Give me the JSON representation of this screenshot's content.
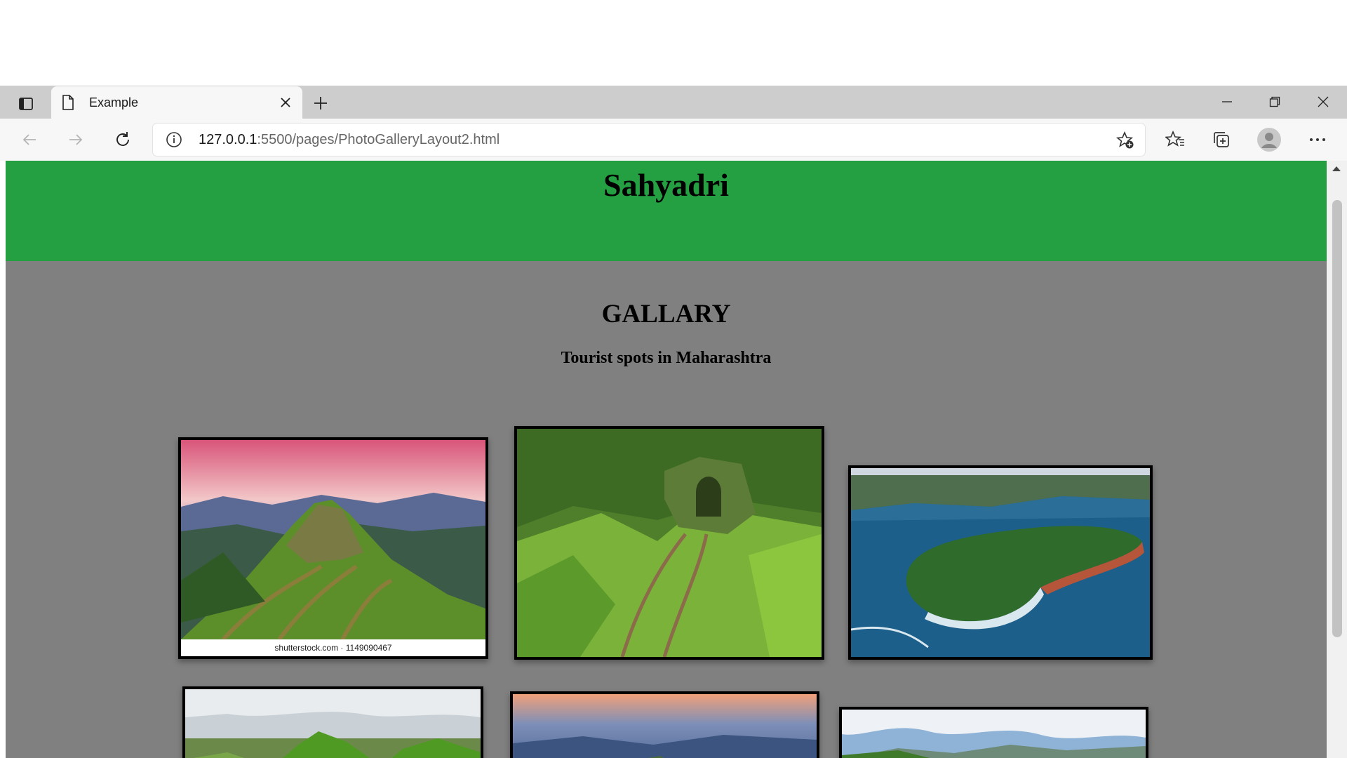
{
  "browser": {
    "tab_title": "Example",
    "url_host": "127.0.0.1",
    "url_rest": ":5500/pages/PhotoGalleryLayout2.html",
    "icons": {
      "tab_actions": "tab-actions-icon",
      "favicon": "page-icon",
      "close": "close-icon",
      "new_tab": "plus-icon",
      "minimize": "minimize-icon",
      "restore": "restore-icon",
      "window_close": "close-icon",
      "back": "back-arrow-icon",
      "forward": "forward-arrow-icon",
      "refresh": "refresh-icon",
      "site_info": "info-icon",
      "add_favorite": "star-add-icon",
      "favorites": "favorites-icon",
      "collections": "collections-icon",
      "profile": "profile-icon",
      "menu": "more-icon"
    }
  },
  "page": {
    "header_title": "Sahyadri",
    "gallery_heading": "GALLARY",
    "gallery_subheading": "Tourist spots in Maharashtra",
    "header_color": "#24a042",
    "background_color": "#808080",
    "photos": [
      {
        "subject": "mountain-fort-sunset",
        "watermark": "shutterstock.com · 1149090467"
      },
      {
        "subject": "green-fort-gate"
      },
      {
        "subject": "island-fort-sea"
      },
      {
        "subject": "green-peaks"
      },
      {
        "subject": "fort-at-dusk"
      },
      {
        "subject": "valley-cloudy-sky"
      }
    ]
  }
}
